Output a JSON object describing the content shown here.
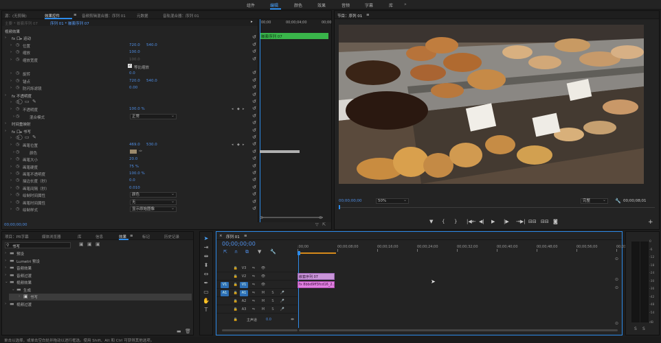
{
  "workspaces": [
    "组件",
    "编辑",
    "颜色",
    "效果",
    "音频",
    "字幕",
    "库"
  ],
  "active_workspace": "编辑",
  "ec_tabs": [
    "源：(无剪辑)",
    "效果控件",
    "音频剪辑混合器：序列 01",
    "元数据",
    "音轨混合器：序列 01"
  ],
  "ec_header": {
    "master": "主要 * 嵌套序列 07",
    "seq": "序列 01 * 嵌套序列 07",
    "mini_clip": "嵌套序列 07",
    "t1": "00;00",
    "t2": "00;00;04;00",
    "t3": "00;00"
  },
  "ec_rows": [
    {
      "label": "视频效果",
      "indent": 0
    },
    {
      "label": "fx 口▸ 运动",
      "indent": 1
    },
    {
      "label": "位置",
      "v1": "720.0",
      "v2": "540.0",
      "indent": 2
    },
    {
      "label": "缩放",
      "v1": "100.0",
      "indent": 2
    },
    {
      "label": "缩放宽度",
      "v1": "100.0",
      "indent": 2,
      "dim": true
    },
    {
      "label": "等比缩放",
      "indent": 6,
      "check": true
    },
    {
      "label": "旋转",
      "v1": "0.0",
      "indent": 2
    },
    {
      "label": "锚点",
      "v1": "720.0",
      "v2": "540.0",
      "indent": 2
    },
    {
      "label": "防闪烁滤镜",
      "v1": "0.00",
      "indent": 2
    },
    {
      "label": "fx 不透明度",
      "indent": 1
    },
    {
      "label": "",
      "indent": 2,
      "shapes": true
    },
    {
      "label": "不透明度",
      "v1": "100.0 %",
      "indent": 2
    },
    {
      "label": "混合模式",
      "dd": "正常",
      "indent": 3
    },
    {
      "label": "时间重映射",
      "indent": 1
    },
    {
      "label": "fx 口▸ 书写",
      "indent": 1
    },
    {
      "label": "",
      "indent": 2,
      "shapes": true
    },
    {
      "label": "画笔位置",
      "v1": "469.0",
      "v2": "530.0",
      "indent": 2
    },
    {
      "label": "颜色",
      "indent": 3,
      "swatch": true
    },
    {
      "label": "画笔大小",
      "v1": "20.0",
      "indent": 2
    },
    {
      "label": "画笔硬度",
      "v1": "75 %",
      "indent": 2
    },
    {
      "label": "画笔不透明度",
      "v1": "100.0 %",
      "indent": 2
    },
    {
      "label": "描边长度（秒）",
      "v1": "0.0",
      "indent": 2
    },
    {
      "label": "画笔间隔（秒）",
      "v1": "0.010",
      "indent": 2
    },
    {
      "label": "绘制时间属性",
      "dd": "颜色",
      "indent": 2
    },
    {
      "label": "画笔时间属性",
      "dd": "无",
      "indent": 2
    },
    {
      "label": "绘制样式",
      "dd": "显示原始图像",
      "indent": 2
    }
  ],
  "ec_timecode": "00;00;00;00",
  "program": {
    "title": "节目：序列 01",
    "timecode": "00;00;00;00",
    "zoom": "50%",
    "quality": "完整",
    "duration": "00;00;08;01"
  },
  "program_controls": [
    "▼",
    "{",
    "}",
    "|◀←",
    "◀|",
    "▶",
    "|▶",
    "→▶|",
    "⊟⊟",
    "⊟⊟",
    "◙"
  ],
  "project_tabs": [
    "项目：PR字幕",
    "媒体浏览器",
    "库",
    "信息",
    "效果",
    "标记",
    "历史记录"
  ],
  "effects_search": "书写",
  "effects_tree": [
    "预设",
    "Lumetri 预设",
    "音频效果",
    "音频过渡",
    "视频效果",
    "生成",
    "书写",
    "视频过渡"
  ],
  "timeline": {
    "title": "序列 01",
    "timecode": "00;00;00;00",
    "ruler": [
      ":00;00",
      "00;00;08;00",
      "00;00;16;00",
      "00;00;24;00",
      "00;00;32;00",
      "00;00;40;00",
      "00;00;48;00",
      "00;00;56;00",
      "00;01;04;02"
    ],
    "tracks": [
      {
        "src": "",
        "name": "V3",
        "m": "",
        "s": ""
      },
      {
        "src": "",
        "name": "V2",
        "m": "",
        "s": ""
      },
      {
        "src": "V1",
        "name": "V1",
        "m": "",
        "s": ""
      },
      {
        "src": "A1",
        "name": "A1",
        "m": "M",
        "s": "S"
      },
      {
        "src": "",
        "name": "A2",
        "m": "M",
        "s": "S"
      },
      {
        "src": "",
        "name": "A3",
        "m": "M",
        "s": "S"
      }
    ],
    "master_label": "主声道",
    "master_val": "0.0",
    "clips": [
      "嵌套序列 07",
      "fx 8bbd9ff3fcd16_2..."
    ]
  },
  "meter_ticks": [
    "0",
    "-6",
    "-12",
    "-18",
    "-24",
    "-30",
    "-36",
    "-42",
    "-48",
    "-54"
  ],
  "meter_unit": "dB",
  "status": "单击以选择，或单击空白处并拖动以进行框选。使用 Shift、Alt 和 Ctrl 可获得其他选项。",
  "colors": {
    "accent": "#2d8ceb",
    "clip_green": "#39b54a",
    "clip_pink": "#e07fe0",
    "timecode": "#4f8ee6"
  }
}
